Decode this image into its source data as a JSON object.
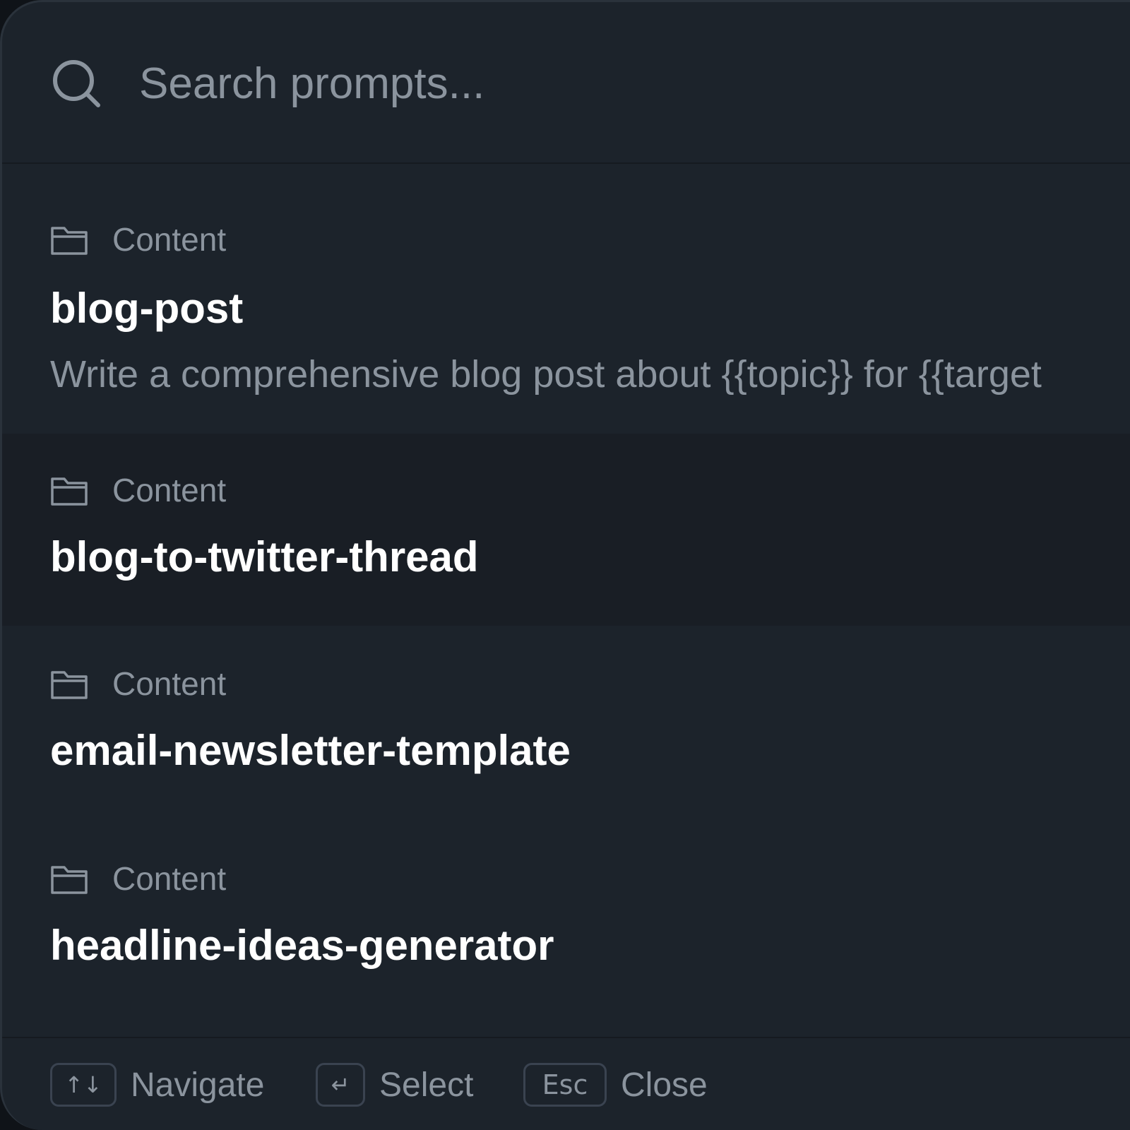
{
  "search": {
    "placeholder": "Search prompts..."
  },
  "items": [
    {
      "category": "Content",
      "title": "blog-post",
      "description": "Write a comprehensive blog post about {{topic}} for {{target"
    },
    {
      "category": "Content",
      "title": "blog-to-twitter-thread"
    },
    {
      "category": "Content",
      "title": "email-newsletter-template"
    },
    {
      "category": "Content",
      "title": "headline-ideas-generator"
    }
  ],
  "footer": {
    "navigate_key": "↑↓",
    "navigate_label": "Navigate",
    "select_key": "↵",
    "select_label": "Select",
    "close_key": "Esc",
    "close_label": "Close"
  },
  "colors": {
    "panel_bg": "#1c232b",
    "selected_bg": "#191e25",
    "muted_text": "#8b949e",
    "title_text": "#ffffff"
  }
}
